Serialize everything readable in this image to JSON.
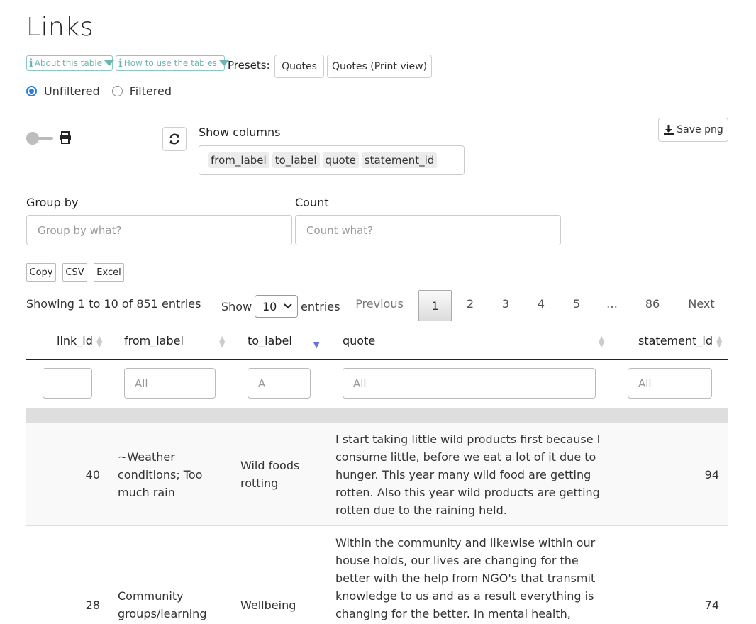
{
  "page": {
    "title": "Links"
  },
  "toolbar": {
    "about_label": "About this table",
    "howto_label": "How to use the tables",
    "presets_label": "Presets:",
    "preset_quotes": "Quotes",
    "preset_quotes_print": "Quotes (Print view)"
  },
  "filter_mode": {
    "unfiltered": "Unfiltered",
    "filtered": "Filtered",
    "selected": "Unfiltered"
  },
  "columns_panel": {
    "show_columns_label": "Show columns",
    "chips": [
      "from_label",
      "to_label",
      "quote",
      "statement_id"
    ],
    "save_png_label": "Save png"
  },
  "grouping": {
    "group_by_label": "Group by",
    "group_by_placeholder": "Group by what?",
    "count_label": "Count",
    "count_placeholder": "Count what?"
  },
  "export": {
    "copy": "Copy",
    "csv": "CSV",
    "excel": "Excel"
  },
  "table_info": {
    "showing": "Showing 1 to 10 of 851 entries",
    "show_label": "Show",
    "page_size": "10",
    "entries_label": "entries"
  },
  "pagination": {
    "previous": "Previous",
    "pages": [
      "1",
      "2",
      "3",
      "4",
      "5"
    ],
    "ellipsis": "…",
    "last": "86",
    "next": "Next",
    "current": "1"
  },
  "table": {
    "headers": [
      "link_id",
      "from_label",
      "to_label",
      "quote",
      "statement_id"
    ],
    "filters": [
      "",
      "All",
      "A",
      "All",
      "All"
    ],
    "rows": [
      {
        "link_id": "40",
        "from_label": "~Weather conditions; Too much rain",
        "to_label": "Wild foods rotting",
        "quote": "I start taking little wild products first because I consume little, before we eat a lot of it due to hunger. This year many wild food are getting rotten. Also this year wild products are getting rotten due to the raining held.",
        "statement_id": "94"
      },
      {
        "link_id": "28",
        "from_label": "Community groups/learning",
        "to_label": "Wellbeing",
        "quote": "Within the community and likewise within our house holds, our lives are changing for the better with the help from NGO's that transmit knowledge to us and as a result everything is changing for the better. In mental health,",
        "statement_id": "74"
      }
    ]
  },
  "colors": {
    "accent": "#2a7be4",
    "info": "#6bb6ae",
    "sort_active": "#6673d8"
  }
}
